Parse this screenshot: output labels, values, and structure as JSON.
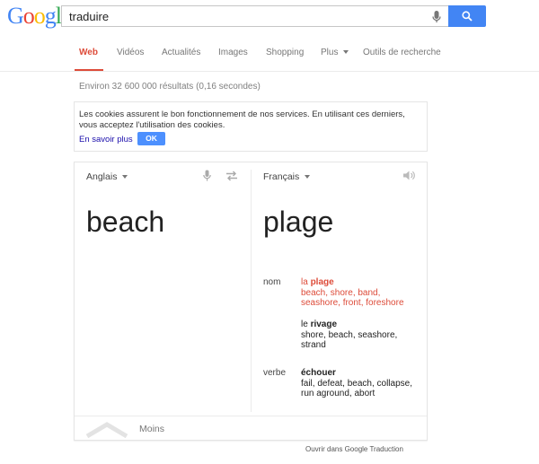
{
  "logo": {
    "letters": [
      "G",
      "o",
      "o",
      "g",
      "l",
      "e"
    ],
    "colors": [
      "#4285f4",
      "#ea4335",
      "#fbbc05",
      "#4285f4",
      "#34a853",
      "#ea4335"
    ]
  },
  "search": {
    "query": "traduire"
  },
  "tabs": [
    {
      "label": "Web",
      "active": true
    },
    {
      "label": "Vidéos"
    },
    {
      "label": "Actualités"
    },
    {
      "label": "Images"
    },
    {
      "label": "Shopping"
    },
    {
      "label": "Plus"
    },
    {
      "label": "Outils de recherche"
    }
  ],
  "result_stats": "Environ 32 600 000 résultats (0,16 secondes)",
  "cookie": {
    "text": "Les cookies assurent le bon fonctionnement de nos services. En utilisant ces derniers, vous acceptez l'utilisation des cookies.",
    "link": "En savoir plus",
    "ok": "OK"
  },
  "translate": {
    "source_lang": "Anglais",
    "target_lang": "Français",
    "source_word": "beach",
    "target_word": "plage",
    "entries": [
      {
        "pos": "nom",
        "article": "la",
        "word": "plage",
        "synonyms": "beach, shore, band, seashore, front, foreshore",
        "highlight": true
      },
      {
        "pos": "",
        "article": "le",
        "word": "rivage",
        "synonyms": "shore, beach, seashore, strand"
      },
      {
        "pos": "verbe",
        "article": "",
        "word": "échouer",
        "synonyms": "fail, defeat, beach, collapse, run aground, abort"
      }
    ],
    "less": "Moins",
    "open_link": "Ouvrir dans Google Traduction"
  }
}
